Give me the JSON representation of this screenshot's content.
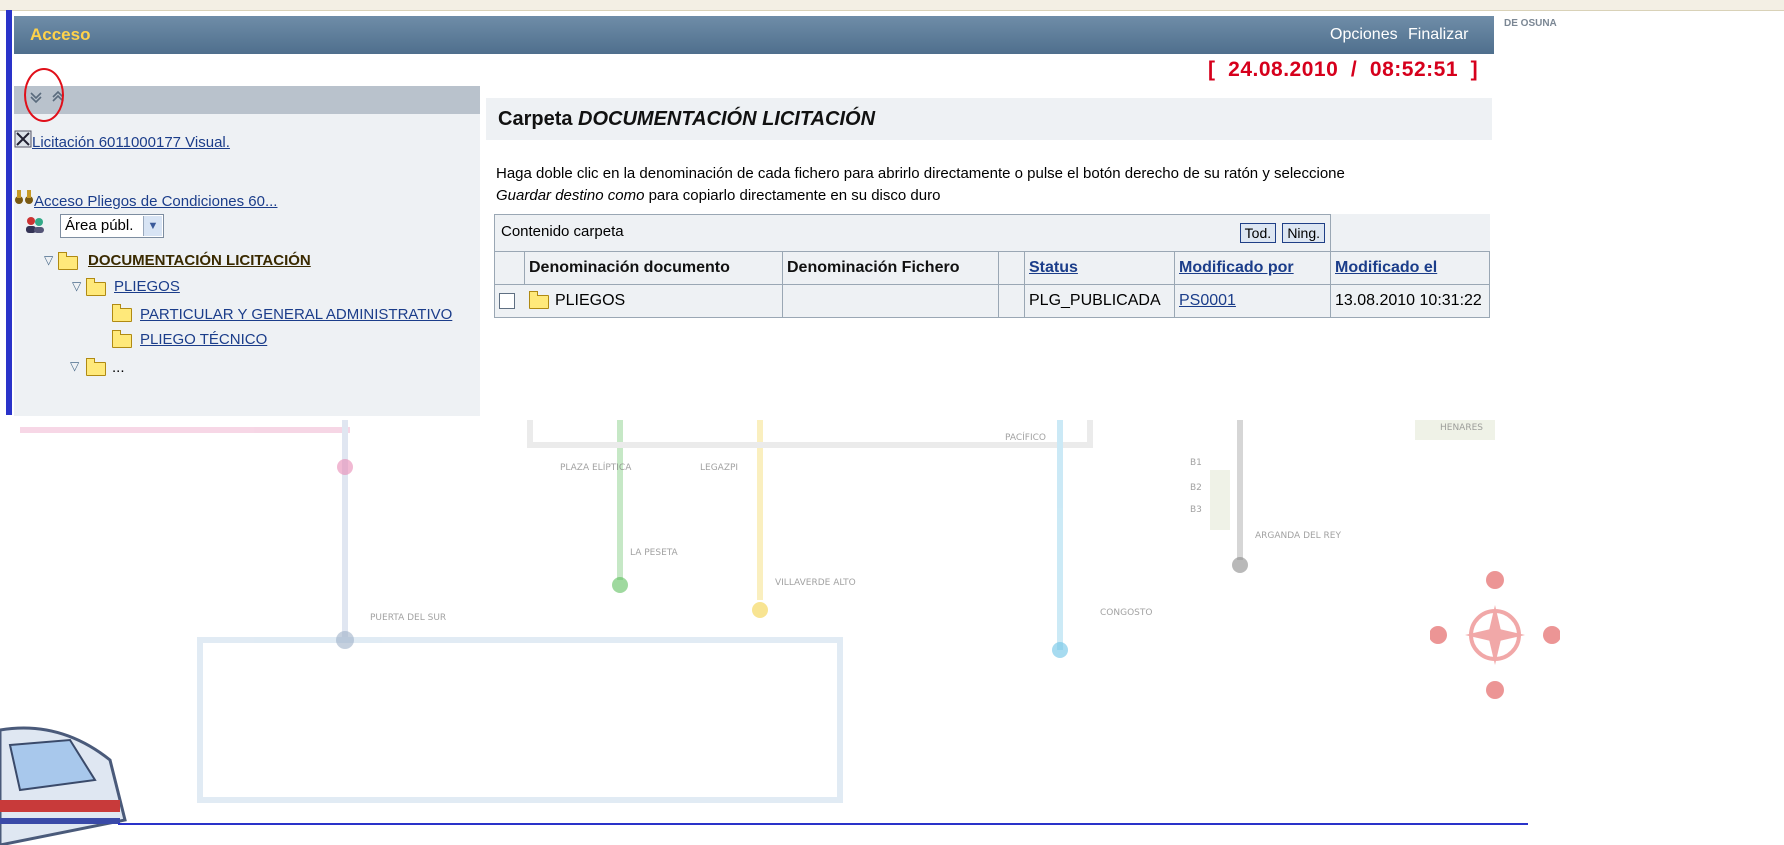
{
  "header": {
    "title": "Acceso",
    "options_label": "Opciones",
    "finish_label": "Finalizar",
    "edge_text": "DE OSUNA"
  },
  "datetime": "[  24.08.2010  /  08:52:51  ]",
  "left_panel": {
    "expand_all_icon": "expand-all-icon",
    "collapse_all_icon": "collapse-all-icon",
    "tender_link": "Licitación 6011000177 Visual.",
    "access_link": "Acceso Pliegos de Condiciones 60...",
    "area_select_value": "Área públ.",
    "tree": {
      "root": "DOCUMENTACIÓN LICITACIÓN",
      "child": "PLIEGOS",
      "grandchildren": [
        "PARTICULAR Y GENERAL ADMINISTRATIVO",
        "PLIEGO TÉCNICO"
      ],
      "more": "..."
    }
  },
  "main": {
    "heading_prefix": "Carpeta ",
    "heading_folder": "DOCUMENTACIÓN LICITACIÓN",
    "instructions_line1": "Haga doble clic en la denominación de cada fichero para abrirlo directamente o pulse el botón derecho de su ratón y seleccione",
    "instructions_italic": "Guardar destino como",
    "instructions_line2": " para copiarlo directamente en su disco duro",
    "table": {
      "caption": "Contenido carpeta",
      "select_all": "Tod.",
      "select_none": "Ning.",
      "columns": [
        "Denominación documento",
        "Denominación Fichero",
        "",
        "Status",
        "Modificado por",
        "Modificado el"
      ],
      "rows": [
        {
          "name": "PLIEGOS",
          "file": "",
          "extra": "",
          "status": "PLG_PUBLICADA",
          "modified_by": "PS0001",
          "modified_on": "13.08.2010 10:31:22"
        }
      ]
    }
  },
  "map_labels": [
    "PLAZA ELÍPTICA",
    "LEGAZPI",
    "LA PESETA",
    "VILLAVERDE ALTO",
    "PACÍFICO",
    "CONGOSTO",
    "ARGANDA DEL REY",
    "HENARES",
    "PUERTA DEL SUR",
    "B1",
    "B2",
    "B3"
  ],
  "colors": {
    "header": "#5a7894",
    "title": "#ffd24a",
    "date": "#d6001c",
    "link": "#1b3d8a",
    "panel": "#eef1f4"
  }
}
